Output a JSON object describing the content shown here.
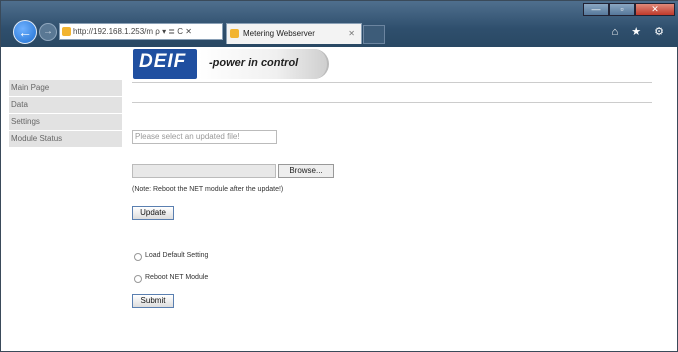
{
  "browser": {
    "address": "http://192.168.1.253/m",
    "address_suffix": "ρ ▾ ≣ C ✕",
    "tab_title": "Metering Webserver",
    "tab_close": "✕",
    "win_min": "—",
    "win_max": "▫",
    "win_close": "✕",
    "back": "←",
    "forward": "→",
    "tool_icons": "⌂ ★ ⚙"
  },
  "logo": {
    "brand": "DEIF",
    "tagline": "-power in control"
  },
  "nav": {
    "items": [
      {
        "label": "Main Page"
      },
      {
        "label": "Data"
      },
      {
        "label": "Settings"
      },
      {
        "label": "Module Status"
      }
    ]
  },
  "upload": {
    "placeholder": "Please select an updated file!",
    "browse_label": "Browse...",
    "note": "(Note: Reboot the NET module after the update!)",
    "update_label": "Update"
  },
  "options": {
    "load_default": "Load Default Setting",
    "reboot": "Reboot NET Module",
    "submit_label": "Submit"
  }
}
